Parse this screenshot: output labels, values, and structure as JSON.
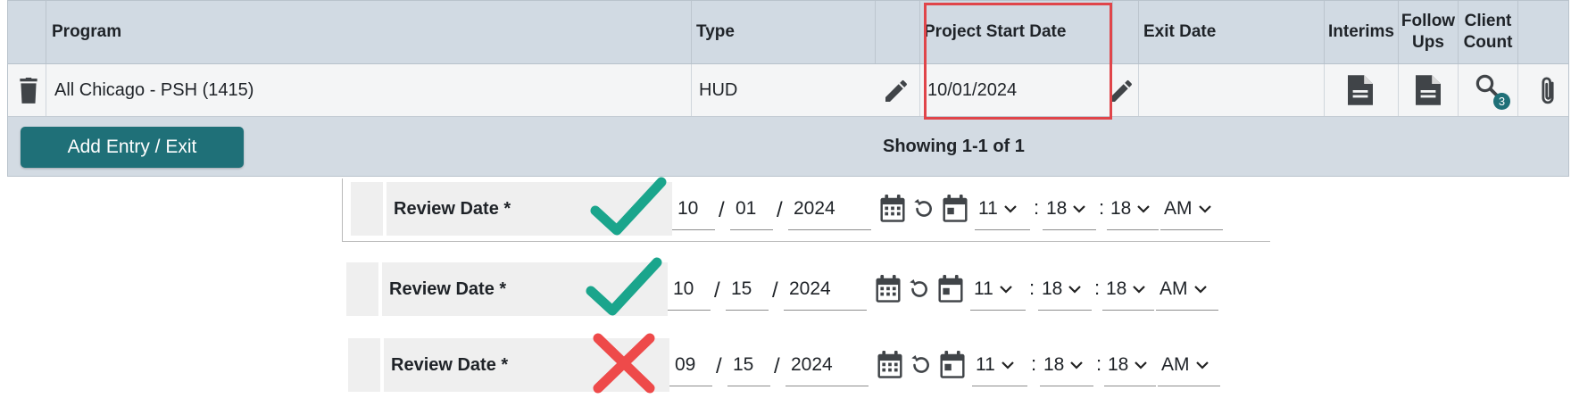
{
  "table": {
    "headers": {
      "program": "Program",
      "type": "Type",
      "project_start_date": "Project Start Date",
      "exit_date": "Exit Date",
      "interims": "Interims",
      "follow_ups": "Follow Ups",
      "client_count": "Client Count"
    },
    "rows": [
      {
        "program": "All Chicago - PSH (1415)",
        "type": "HUD",
        "project_start_date": "10/01/2024",
        "exit_date": "",
        "client_count_badge": "3"
      }
    ],
    "add_button_label": "Add Entry / Exit",
    "showing_text": "Showing 1-1 of 1"
  },
  "review_rows": [
    {
      "label": "Review Date *",
      "month": "10",
      "day": "01",
      "year": "2024",
      "hour": "11",
      "minute": "18",
      "second": "18",
      "ampm": "AM",
      "valid": true
    },
    {
      "label": "Review Date *",
      "month": "10",
      "day": "15",
      "year": "2024",
      "hour": "11",
      "minute": "18",
      "second": "18",
      "ampm": "AM",
      "valid": true
    },
    {
      "label": "Review Date *",
      "month": "09",
      "day": "15",
      "year": "2024",
      "hour": "11",
      "minute": "18",
      "second": "18",
      "ampm": "AM",
      "valid": false
    }
  ],
  "separators": {
    "date": "/",
    "time": ":"
  },
  "colors": {
    "accent": "#1f7078",
    "check": "#1aa58c",
    "cross": "#ee4a4a",
    "highlight_box": "#e0454a",
    "table_header_bg": "#d1dae3"
  },
  "icons": {
    "delete": "trash-icon",
    "edit": "pencil-icon",
    "interims": "document-icon",
    "follow_ups": "document-icon",
    "client_count": "search-icon",
    "attachment": "paperclip-icon",
    "calendar": "calendar-icon",
    "reset": "undo-icon",
    "today": "calendar-today-icon",
    "valid": "checkmark-icon",
    "invalid": "x-mark-icon"
  }
}
